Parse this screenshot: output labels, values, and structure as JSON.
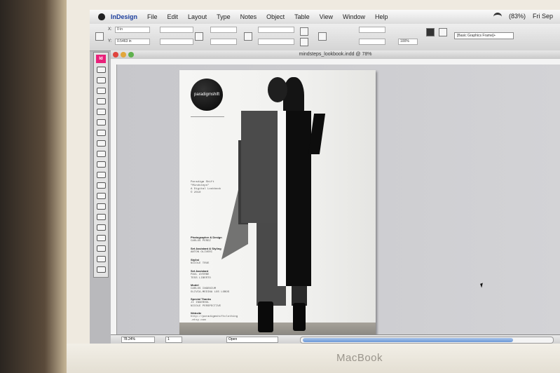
{
  "device": {
    "brand": "MacBook"
  },
  "menubar": {
    "app": "InDesign",
    "items": [
      "File",
      "Edit",
      "Layout",
      "Type",
      "Notes",
      "Object",
      "Table",
      "View",
      "Window",
      "Help"
    ],
    "battery": "(83%)",
    "clock": "Fri Sep"
  },
  "control_panel": {
    "x_label": "X:",
    "x_value": "0 in",
    "y_label": "Y:",
    "y_value": "0.5463 in",
    "zoom_field": "100%",
    "style_dropdown": "[Basic Graphics Frame]+"
  },
  "tools": {
    "badge": "Id"
  },
  "document": {
    "title": "mindsteps_lookbook.indd @ 78%"
  },
  "page": {
    "logo_text": "paradigmshift",
    "intro_text": "Paradigm Shift\n\"Mindsteps\"\nA Digital Lookbook\n© 2010",
    "credits": [
      {
        "heading": "Photographer & Design",
        "body": "CARLOS PEREZ"
      },
      {
        "heading": "Set Assistant & Styling",
        "body": "ANTON OLIVERI"
      },
      {
        "heading": "Stylist",
        "body": "NICOLE TRUE"
      },
      {
        "heading": "Set Assistant",
        "body": "PAUL AYERBE\nTESS LIBERTO"
      },
      {
        "heading": "Model",
        "body": "CARLOS INGENIUM\nOLIVIA-MEDINA LOS LOBOS"
      },
      {
        "heading": "Special Thanks",
        "body": "JI INGERHOL\nNICOLE PERSPECTIVE"
      },
      {
        "heading": "Website",
        "body": "http://paradigmshiftclothing\n.etsy.com"
      }
    ]
  },
  "statusbar": {
    "zoom": "78.24%",
    "page": "1",
    "status": "Open"
  }
}
